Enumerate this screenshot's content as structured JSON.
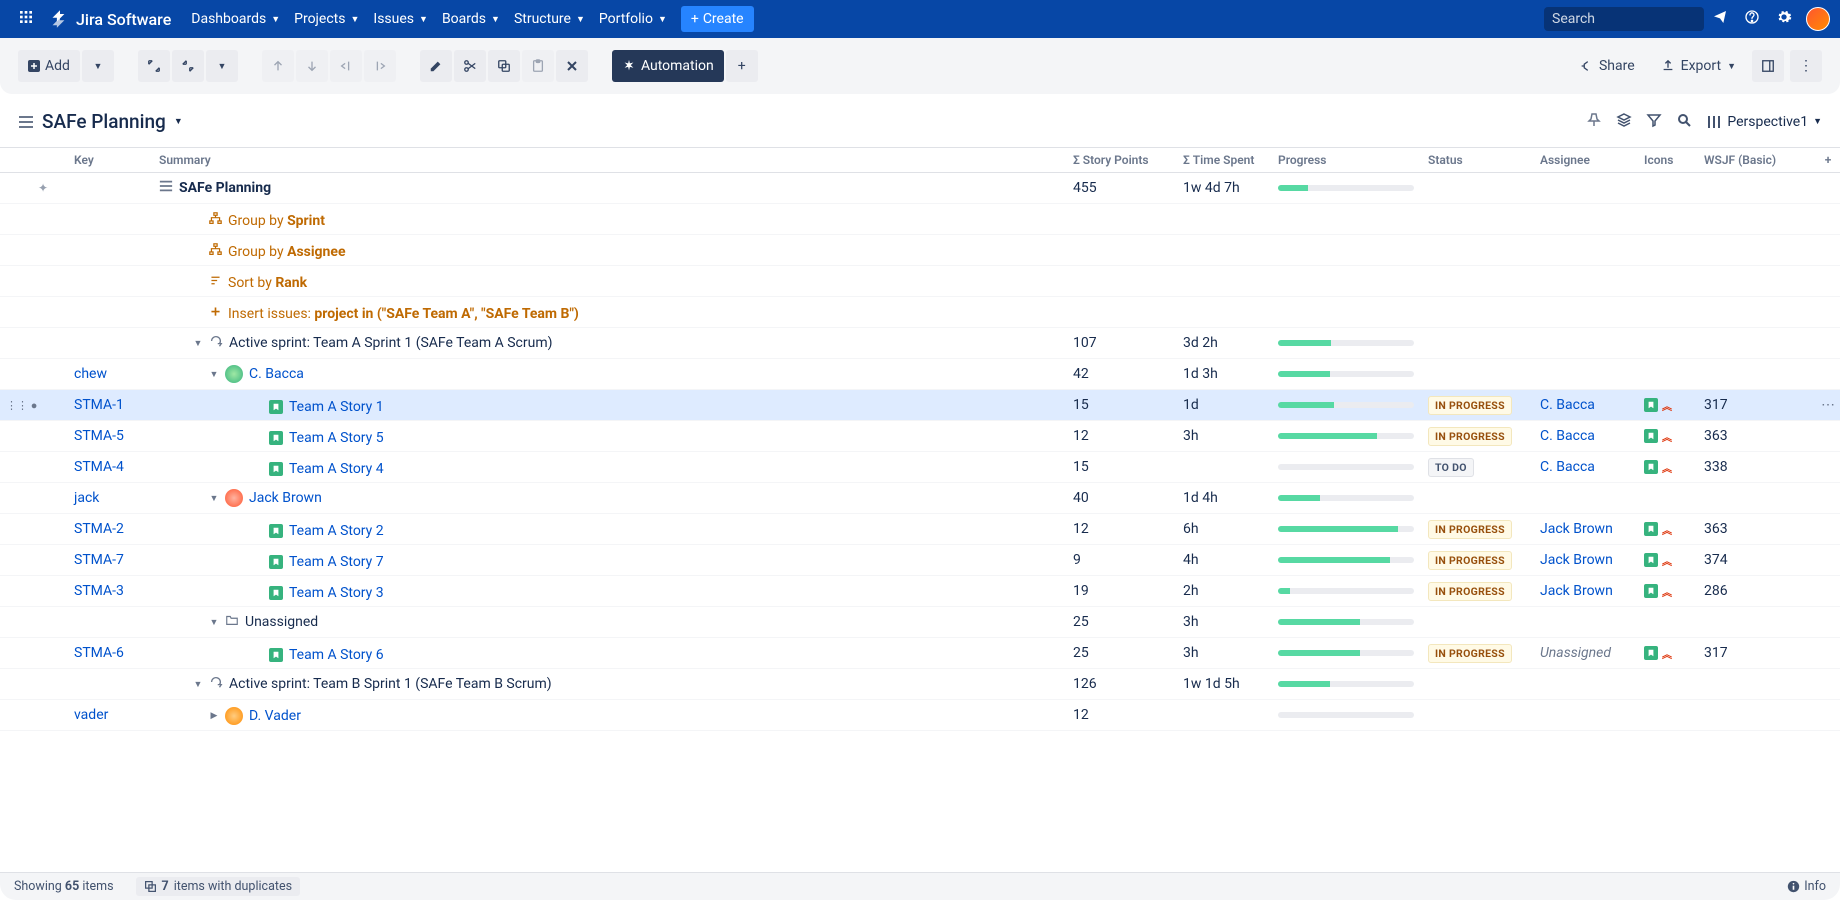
{
  "nav": {
    "product": "Jira Software",
    "menu": [
      "Dashboards",
      "Projects",
      "Issues",
      "Boards",
      "Structure",
      "Portfolio"
    ],
    "create": "Create",
    "search_placeholder": "Search"
  },
  "toolbar": {
    "add": "Add",
    "automation": "Automation",
    "share": "Share",
    "export": "Export"
  },
  "structure": {
    "title": "SAFe Planning",
    "perspective": "Perspective1"
  },
  "columns": {
    "key": "Key",
    "summary": "Summary",
    "sp": "Σ Story Points",
    "ts": "Σ Time Spent",
    "progress": "Progress",
    "status": "Status",
    "assignee": "Assignee",
    "icons": "Icons",
    "wsjf": "WSJF (Basic)"
  },
  "rows": [
    {
      "type": "root",
      "indent": 0,
      "summary": "SAFe Planning",
      "sp": "455",
      "ts": "1w 4d 7h",
      "progress": 22
    },
    {
      "type": "gen",
      "indent": 1,
      "kind": "group",
      "text_a": "Group by ",
      "text_b": "Sprint"
    },
    {
      "type": "gen",
      "indent": 1,
      "kind": "group",
      "text_a": "Group by ",
      "text_b": "Assignee"
    },
    {
      "type": "gen",
      "indent": 1,
      "kind": "sort",
      "text_a": "Sort by ",
      "text_b": "Rank"
    },
    {
      "type": "gen",
      "indent": 1,
      "kind": "insert",
      "text_a": "Insert issues: ",
      "text_b": "project in (\"SAFe Team A\", \"SAFe Team B\")"
    },
    {
      "type": "sprint",
      "indent": 1,
      "exp": "down",
      "summary": "Active sprint: Team A Sprint 1 (SAFe Team A Scrum)",
      "sp": "107",
      "ts": "3d 2h",
      "progress": 39
    },
    {
      "type": "person",
      "indent": 2,
      "exp": "down",
      "key": "chew",
      "avatar": "bacca",
      "summary": "C. Bacca",
      "sp": "42",
      "ts": "1d 3h",
      "progress": 38
    },
    {
      "type": "issue",
      "indent": 3,
      "key": "STMA-1",
      "summary": "Team A Story 1",
      "sp": "15",
      "ts": "1d",
      "progress": 41,
      "status": "IN PROGRESS",
      "assignee": "C. Bacca",
      "wsjf": "317",
      "selected": true,
      "more": true
    },
    {
      "type": "issue",
      "indent": 3,
      "key": "STMA-5",
      "summary": "Team A Story 5",
      "sp": "12",
      "ts": "3h",
      "progress": 73,
      "status": "IN PROGRESS",
      "assignee": "C. Bacca",
      "wsjf": "363"
    },
    {
      "type": "issue",
      "indent": 3,
      "key": "STMA-4",
      "summary": "Team A Story 4",
      "sp": "15",
      "ts": "",
      "progress": 0,
      "status": "TO DO",
      "assignee": "C. Bacca",
      "wsjf": "338"
    },
    {
      "type": "person",
      "indent": 2,
      "exp": "down",
      "key": "jack",
      "avatar": "jack",
      "summary": "Jack Brown",
      "sp": "40",
      "ts": "1d 4h",
      "progress": 31
    },
    {
      "type": "issue",
      "indent": 3,
      "key": "STMA-2",
      "summary": "Team A Story 2",
      "sp": "12",
      "ts": "6h",
      "progress": 88,
      "status": "IN PROGRESS",
      "assignee": "Jack Brown",
      "wsjf": "363"
    },
    {
      "type": "issue",
      "indent": 3,
      "key": "STMA-7",
      "summary": "Team A Story 7",
      "sp": "9",
      "ts": "4h",
      "progress": 82,
      "status": "IN PROGRESS",
      "assignee": "Jack Brown",
      "wsjf": "374"
    },
    {
      "type": "issue",
      "indent": 3,
      "key": "STMA-3",
      "summary": "Team A Story 3",
      "sp": "19",
      "ts": "2h",
      "progress": 9,
      "status": "IN PROGRESS",
      "assignee": "Jack Brown",
      "wsjf": "286"
    },
    {
      "type": "folder",
      "indent": 2,
      "exp": "down",
      "summary": "Unassigned",
      "sp": "25",
      "ts": "3h",
      "progress": 60
    },
    {
      "type": "issue",
      "indent": 3,
      "key": "STMA-6",
      "summary": "Team A Story 6",
      "sp": "25",
      "ts": "3h",
      "progress": 60,
      "status": "IN PROGRESS",
      "assignee": "Unassigned",
      "unassigned": true,
      "wsjf": "317"
    },
    {
      "type": "sprint",
      "indent": 1,
      "exp": "down",
      "summary": "Active sprint: Team B Sprint 1 (SAFe Team B Scrum)",
      "sp": "126",
      "ts": "1w 1d 5h",
      "progress": 38
    },
    {
      "type": "person",
      "indent": 2,
      "exp": "right",
      "key": "vader",
      "avatar": "vader",
      "summary": "D. Vader",
      "sp": "12",
      "ts": "",
      "progress": 0,
      "progress_empty": true
    }
  ],
  "footer": {
    "showing_a": "Showing ",
    "count": "65",
    "showing_b": " items",
    "dup_count": "7",
    "dup_text": " items with duplicates",
    "info": "Info"
  }
}
